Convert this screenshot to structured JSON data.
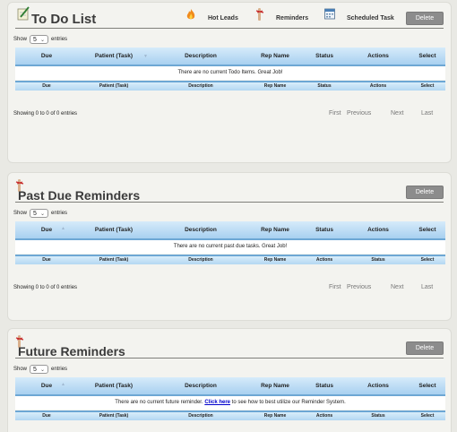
{
  "todo": {
    "title": "To Do List",
    "hot_leads": "Hot Leads",
    "reminders": "Reminders",
    "scheduled_task": "Scheduled Task",
    "delete": "Delete",
    "show": "Show",
    "entries": "entries",
    "entries_value": "5",
    "columns": [
      "Due",
      "Patient (Task)",
      "Description",
      "Rep Name",
      "Status",
      "Actions",
      "Select"
    ],
    "footer_columns": [
      "Due",
      "Patient (Task)",
      "Description",
      "Rep Name",
      "Status",
      "Actions",
      "Select"
    ],
    "empty_message": "There are no current Todo Items. Great Job!",
    "info": "Showing 0 to 0 of 0 entries",
    "pager": [
      "First",
      "Previous",
      "Next",
      "Last"
    ]
  },
  "past_due": {
    "title": "Past Due Reminders",
    "delete": "Delete",
    "show": "Show",
    "entries": "entries",
    "entries_value": "5",
    "columns": [
      "Due",
      "Patient (Task)",
      "Description",
      "Rep Name",
      "Status",
      "Actions",
      "Select"
    ],
    "footer_columns": [
      "Due",
      "Patient (Task)",
      "Description",
      "Rep Name",
      "Actions",
      "Status",
      "Select"
    ],
    "empty_message": "There are no current past due tasks. Great Job!",
    "info": "Showing 0 to 0 of 0 entries",
    "pager": [
      "First",
      "Previous",
      "Next",
      "Last"
    ]
  },
  "future": {
    "title": "Future Reminders",
    "delete": "Delete",
    "show": "Show",
    "entries": "entries",
    "entries_value": "5",
    "columns": [
      "Due",
      "Patient (Task)",
      "Description",
      "Rep Name",
      "Status",
      "Actions",
      "Select"
    ],
    "footer_columns": [
      "Due",
      "Patient (Task)",
      "Description",
      "Rep Name",
      "Actions",
      "Status",
      "Select"
    ],
    "empty_before": "There are no current future reminder.",
    "empty_link": "Click here",
    "empty_after": "to see how to best utilize our Reminder System."
  }
}
